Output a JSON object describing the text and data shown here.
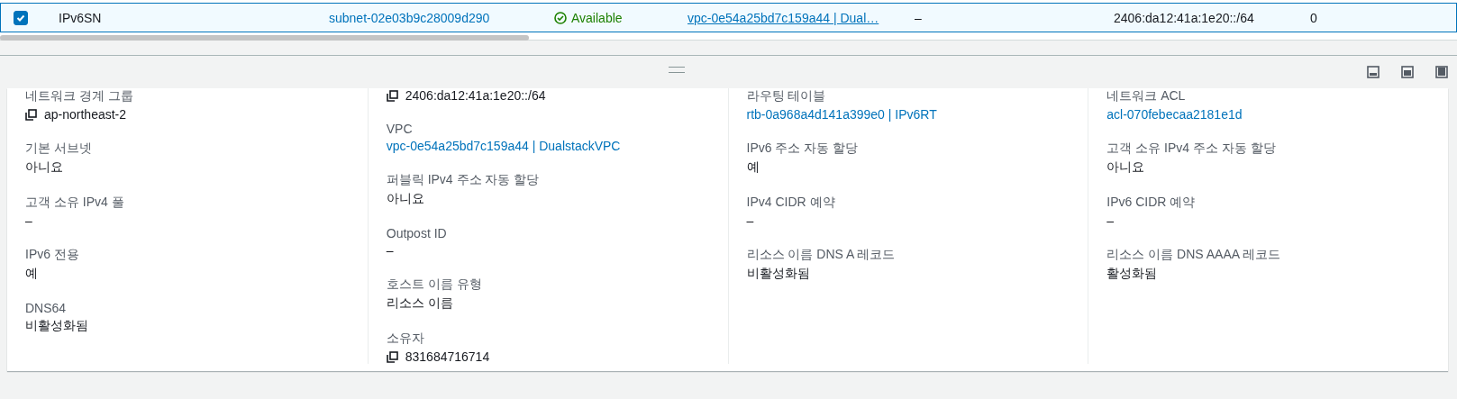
{
  "table": {
    "rows": [
      {
        "selected": true,
        "checked": true,
        "cells": [
          {
            "kind": "text",
            "text": "IPv6SN"
          },
          {
            "kind": "link",
            "text": "subnet-02e03b9c28009d290"
          },
          {
            "kind": "status",
            "text": "Available"
          },
          {
            "kind": "link-underline",
            "text": "vpc-0e54a25bd7c159a44 | Dual…"
          },
          {
            "kind": "text",
            "text": "–"
          },
          {
            "kind": "text",
            "text": "2406:da12:41a:1e20::/64"
          },
          {
            "kind": "text",
            "text": "0"
          }
        ]
      }
    ]
  },
  "details": {
    "columns": [
      {
        "items": [
          {
            "label": "네트워크 경계 그룹",
            "value": "ap-northeast-2",
            "kind": "copy"
          },
          {
            "label": "기본 서브넷",
            "value": "아니요",
            "kind": "text"
          },
          {
            "label": "고객 소유 IPv4 풀",
            "value": "–",
            "kind": "text"
          },
          {
            "label": "IPv6 전용",
            "value": "예",
            "kind": "text"
          },
          {
            "label": "DNS64",
            "value": "비활성화됨",
            "kind": "text"
          }
        ]
      },
      {
        "items": [
          {
            "value": "2406:da12:41a:1e20::/64",
            "kind": "copy"
          },
          {
            "label": "VPC",
            "value": "vpc-0e54a25bd7c159a44 | DualstackVPC",
            "kind": "link"
          },
          {
            "label": "퍼블릭 IPv4 주소 자동 할당",
            "value": "아니요",
            "kind": "text"
          },
          {
            "label": "Outpost ID",
            "value": "–",
            "kind": "text"
          },
          {
            "label": "호스트 이름 유형",
            "value": "리소스 이름",
            "kind": "text"
          },
          {
            "label": "소유자",
            "value": "831684716714",
            "kind": "copy"
          }
        ]
      },
      {
        "items": [
          {
            "label": "라우팅 테이블",
            "value": "rtb-0a968a4d141a399e0 | IPv6RT",
            "kind": "link"
          },
          {
            "label": "IPv6 주소 자동 할당",
            "value": "예",
            "kind": "text"
          },
          {
            "label": "IPv4 CIDR 예약",
            "value": "–",
            "kind": "text"
          },
          {
            "label": "리소스 이름 DNS A 레코드",
            "value": "비활성화됨",
            "kind": "text"
          }
        ]
      },
      {
        "items": [
          {
            "label": "네트워크 ACL",
            "value": "acl-070febecaa2181e1d",
            "kind": "link"
          },
          {
            "label": "고객 소유 IPv4 주소 자동 할당",
            "value": "아니요",
            "kind": "text"
          },
          {
            "label": "IPv6 CIDR 예약",
            "value": "–",
            "kind": "text"
          },
          {
            "label": "리소스 이름 DNS AAAA 레코드",
            "value": "활성화됨",
            "kind": "text"
          }
        ]
      }
    ]
  }
}
